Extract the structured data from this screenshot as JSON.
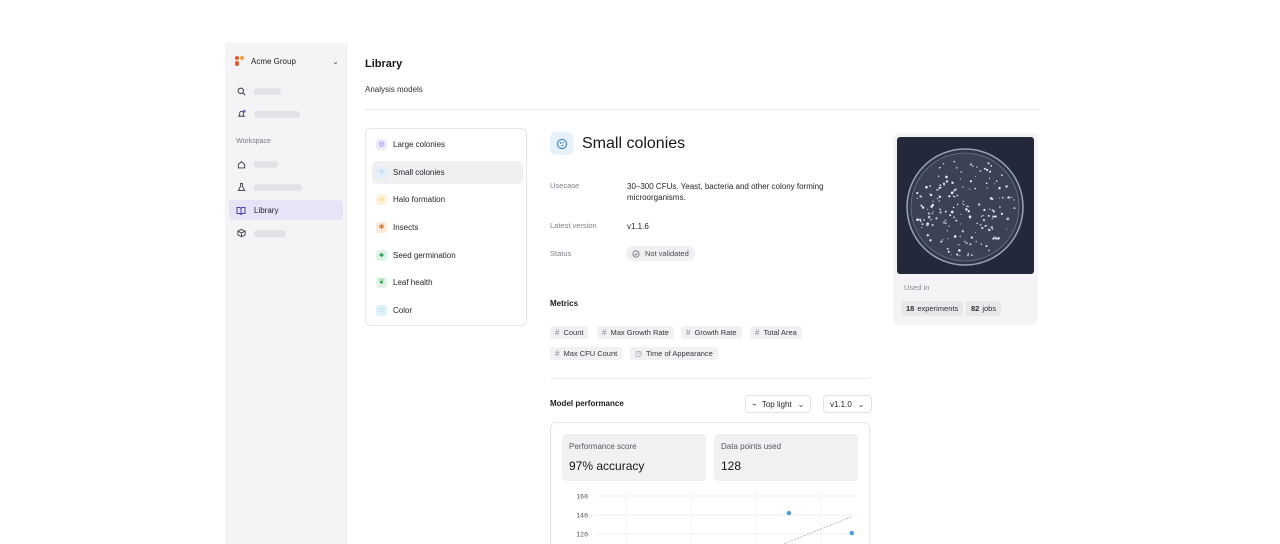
{
  "sidebar": {
    "org_name": "Acme Group",
    "workspace_label": "Workspace",
    "active_item": "Library",
    "accent_color": "#6b5bd6"
  },
  "header": {
    "title": "Library",
    "subtitle": "Analysis models"
  },
  "models": [
    {
      "label": "Large colonies",
      "icon": "colony-icon",
      "color": "#7c6fe0",
      "bg": "#ecebfb"
    },
    {
      "label": "Small colonies",
      "icon": "colony-small-icon",
      "color": "#3b82c4",
      "bg": "#e3eefa"
    },
    {
      "label": "Halo formation",
      "icon": "sun-icon",
      "color": "#e0a11b",
      "bg": "#fdf3da"
    },
    {
      "label": "Insects",
      "icon": "bug-icon",
      "color": "#e0742b",
      "bg": "#fde9da"
    },
    {
      "label": "Seed germination",
      "icon": "sprout-icon",
      "color": "#1f9d55",
      "bg": "#dcf3e6"
    },
    {
      "label": "Leaf health",
      "icon": "leaf-icon",
      "color": "#33a35b",
      "bg": "#e2f4e7"
    },
    {
      "label": "Color",
      "icon": "palette-icon",
      "color": "#3aa3c9",
      "bg": "#def1f8"
    }
  ],
  "detail": {
    "title": "Small colonies",
    "usecase_label": "Usecase",
    "usecase_value": "30–300 CFUs. Yeast, bacteria and other colony forming microorganisms.",
    "version_label": "Latest version",
    "version_value": "v1.1.6",
    "status_label": "Status",
    "status_value": "Not validated",
    "metrics_title": "Metrics",
    "metrics": [
      "Count",
      "Max Growth Rate",
      "Growth Rate",
      "Total Area",
      "Max CFU Count",
      "Time of Appearance"
    ],
    "performance_title": "Model performance",
    "lighting_select": "Top light",
    "version_select": "v1.1.0",
    "score_label": "Performance score",
    "score_value": "97% accuracy",
    "points_label": "Data points used",
    "points_value": "128"
  },
  "preview": {
    "used_in_label": "Used in",
    "experiments_count": "18",
    "experiments_label": "experiments",
    "jobs_count": "82",
    "jobs_label": "jobs"
  },
  "chart_data": {
    "type": "scatter",
    "y_ticks": [
      "160",
      "140",
      "120"
    ],
    "points": [
      {
        "x": 0.74,
        "y": 142
      },
      {
        "x": 0.98,
        "y": 121
      }
    ],
    "trend_line": true,
    "point_color": "#4a9de0"
  }
}
